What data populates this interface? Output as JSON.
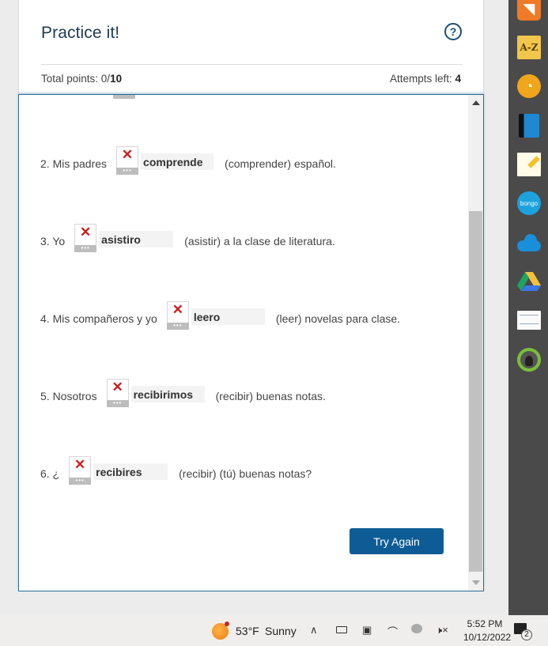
{
  "header": {
    "title": "Practice it!",
    "help_icon": "?",
    "points_label": "Total points: 0/",
    "points_total": "10",
    "attempts_label": "Attempts left: ",
    "attempts_value": "4"
  },
  "questions": [
    {
      "prefix": "2. Mis padres",
      "answer": "comprende",
      "suffix": "(comprender) español.",
      "status": "incorrect",
      "mark": "✕",
      "more": "•••"
    },
    {
      "prefix": "3. Yo",
      "answer": "asistiro",
      "suffix": "(asistir) a la clase de literatura.",
      "status": "incorrect",
      "mark": "✕",
      "more": "•••"
    },
    {
      "prefix": "4. Mis compañeros y yo",
      "answer": "leero",
      "suffix": "(leer) novelas para clase.",
      "status": "incorrect",
      "mark": "✕",
      "more": "•••"
    },
    {
      "prefix": "5. Nosotros",
      "answer": "recibirimos",
      "suffix": "(recibir) buenas notas.",
      "status": "incorrect",
      "mark": "✕",
      "more": "•••"
    },
    {
      "prefix": "6. ¿",
      "answer": "recibires",
      "suffix": "(recibir) (tú) buenas notas?",
      "status": "incorrect",
      "mark": "✕",
      "more": "•••"
    }
  ],
  "actions": {
    "try_again": "Try Again"
  },
  "sidebar": {
    "icons": [
      "rss-icon",
      "a-z-icon",
      "b-icon",
      "book-icon",
      "notepad-icon",
      "bongo-icon",
      "onedrive-icon",
      "google-drive-icon",
      "flashcards-icon",
      "avatar-icon"
    ],
    "az_label": "A-Z",
    "bongo_label": "bongo"
  },
  "taskbar": {
    "temperature": "53°F",
    "condition": "Sunny",
    "time": "5:52 PM",
    "date": "10/12/2022",
    "notification_count": "2"
  },
  "colors": {
    "accent": "#0e5c96",
    "error": "#cc1e1e",
    "title": "#1d3b4f"
  }
}
